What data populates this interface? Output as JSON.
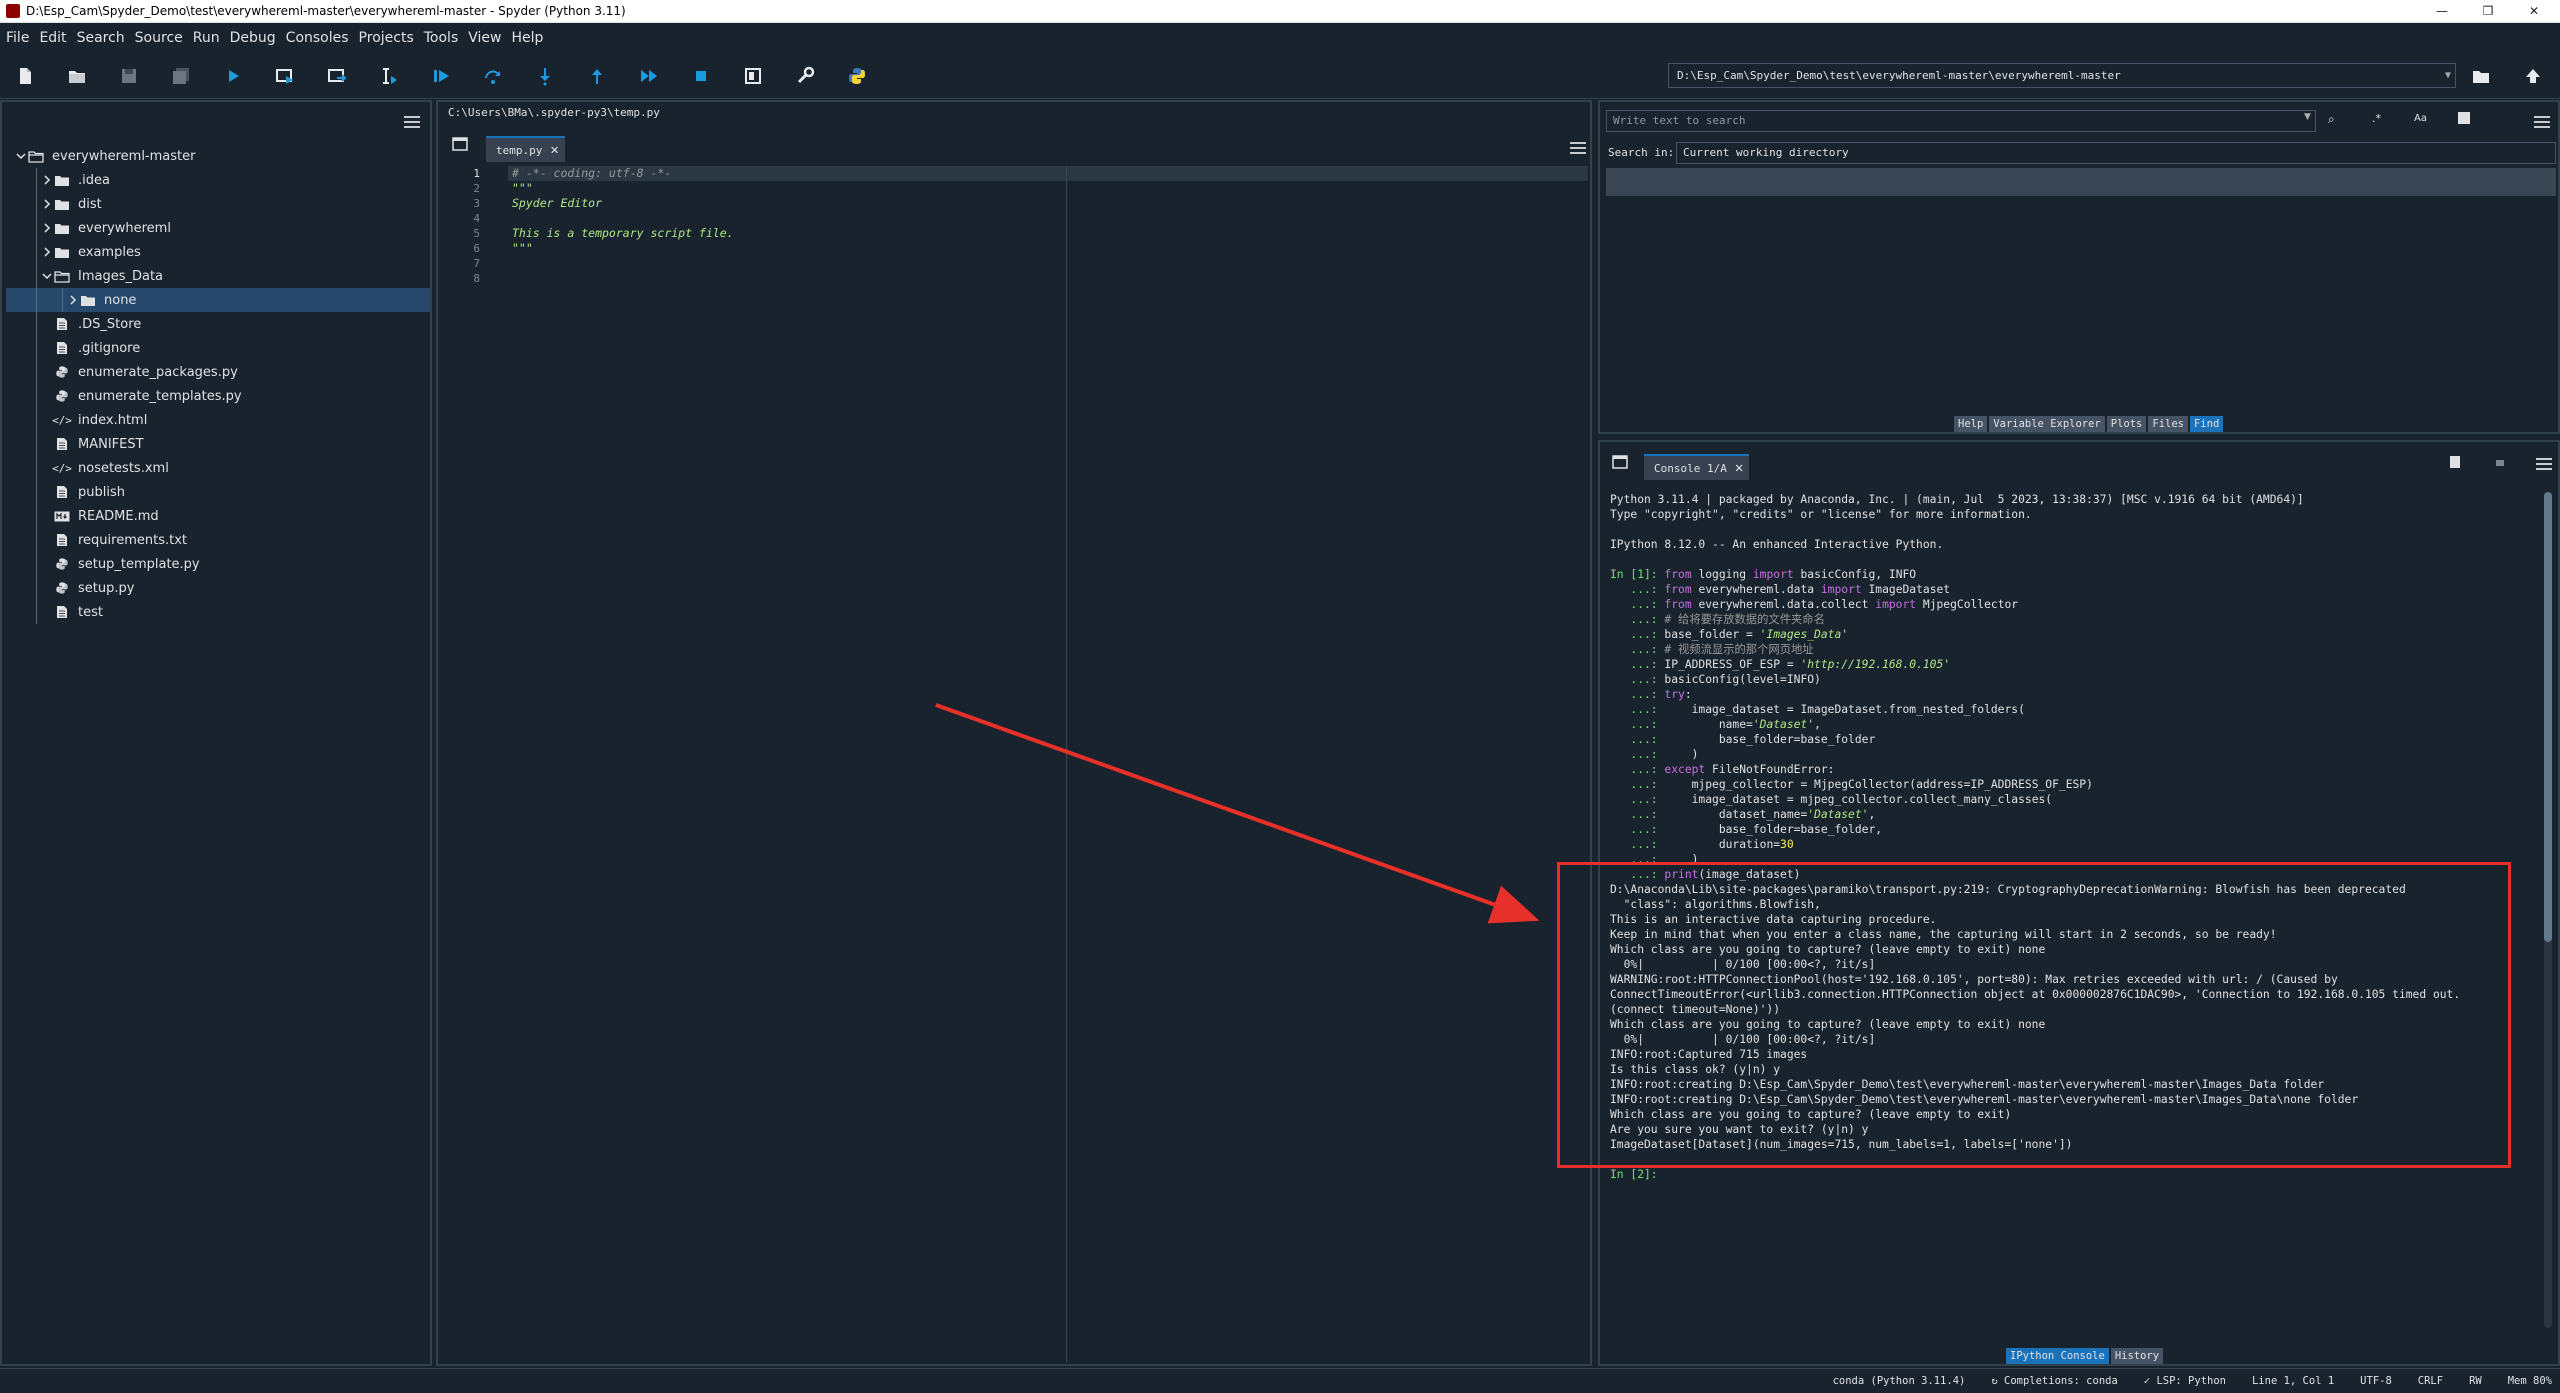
{
  "window": {
    "title": "D:\\Esp_Cam\\Spyder_Demo\\test\\everywhereml-master\\everywhereml-master - Spyder (Python 3.11)",
    "controls": [
      "—",
      "❐",
      "✕"
    ]
  },
  "menu": [
    "File",
    "Edit",
    "Search",
    "Source",
    "Run",
    "Debug",
    "Consoles",
    "Projects",
    "Tools",
    "View",
    "Help"
  ],
  "toolbar": {
    "working_dir": "D:\\Esp_Cam\\Spyder_Demo\\test\\everywhereml-master\\everywhereml-master",
    "icons": [
      "new-file-icon",
      "open-file-icon",
      "save-icon",
      "save-all-icon",
      "run-icon",
      "run-cell-icon",
      "run-cell-advance-icon",
      "run-selection-icon",
      "debug-icon",
      "step-over-icon",
      "step-into-icon",
      "step-return-icon",
      "continue-icon",
      "stop-debug-icon",
      "maximize-pane-icon",
      "preferences-icon",
      "python-path-icon"
    ]
  },
  "files": {
    "root": "everywhereml-master",
    "items": [
      {
        "label": ".idea",
        "type": "folder",
        "depth": 1,
        "expanded": false
      },
      {
        "label": "dist",
        "type": "folder",
        "depth": 1,
        "expanded": false
      },
      {
        "label": "everywhereml",
        "type": "folder",
        "depth": 1,
        "expanded": false
      },
      {
        "label": "examples",
        "type": "folder",
        "depth": 1,
        "expanded": false
      },
      {
        "label": "Images_Data",
        "type": "folder",
        "depth": 1,
        "expanded": true
      },
      {
        "label": "none",
        "type": "folder",
        "depth": 2,
        "expanded": false,
        "selected": true
      },
      {
        "label": ".DS_Store",
        "type": "file",
        "depth": 1
      },
      {
        "label": ".gitignore",
        "type": "file",
        "depth": 1
      },
      {
        "label": "enumerate_packages.py",
        "type": "python",
        "depth": 1
      },
      {
        "label": "enumerate_templates.py",
        "type": "python",
        "depth": 1
      },
      {
        "label": "index.html",
        "type": "code",
        "depth": 1
      },
      {
        "label": "MANIFEST",
        "type": "file",
        "depth": 1
      },
      {
        "label": "nosetests.xml",
        "type": "code",
        "depth": 1
      },
      {
        "label": "publish",
        "type": "file",
        "depth": 1
      },
      {
        "label": "README.md",
        "type": "markdown",
        "depth": 1
      },
      {
        "label": "requirements.txt",
        "type": "file",
        "depth": 1
      },
      {
        "label": "setup_template.py",
        "type": "python",
        "depth": 1
      },
      {
        "label": "setup.py",
        "type": "python",
        "depth": 1
      },
      {
        "label": "test",
        "type": "file",
        "depth": 1
      }
    ]
  },
  "editor": {
    "path": "C:\\Users\\BMa\\.spyder-py3\\temp.py",
    "tab_label": "temp.py",
    "line_numbers": [
      "1",
      "2",
      "3",
      "4",
      "5",
      "6",
      "7",
      "8"
    ],
    "lines": [
      {
        "text": "# -*- coding: utf-8 -*-",
        "color": "#999999",
        "italic": true
      },
      {
        "text": "\"\"\"",
        "color": "#b0e686",
        "italic": true
      },
      {
        "text": "Spyder Editor",
        "color": "#b0e686",
        "italic": true
      },
      {
        "text": "",
        "color": "#b0e686",
        "italic": true
      },
      {
        "text": "This is a temporary script file.",
        "color": "#b0e686",
        "italic": true
      },
      {
        "text": "\"\"\"",
        "color": "#b0e686",
        "italic": true
      },
      {
        "text": "",
        "color": "#e0e1e3",
        "italic": false
      },
      {
        "text": "",
        "color": "#e0e1e3",
        "italic": false
      }
    ]
  },
  "find": {
    "search_placeholder": "Write text to search",
    "search_in_label": "Search in:",
    "search_in_value": "Current working directory",
    "tabs": [
      "Help",
      "Variable Explorer",
      "Plots",
      "Files",
      "Find"
    ],
    "active_tab": "Find"
  },
  "console": {
    "tab_label": "Console 1/A",
    "bottom_tabs": [
      "IPython Console",
      "History"
    ],
    "active_bottom_tab": "IPython Console",
    "lines": [
      [
        {
          "t": "Python 3.11.4 | packaged by Anaconda, Inc. | (main, Jul  5 2023, 13:38:37) [MSC v.1916 64 bit (AMD64)]"
        }
      ],
      [
        {
          "t": "Type \"copyright\", \"credits\" or \"license\" for more information."
        }
      ],
      [
        {
          "t": ""
        }
      ],
      [
        {
          "t": "IPython 8.12.0 -- An enhanced Interactive Python."
        }
      ],
      [
        {
          "t": ""
        }
      ],
      [
        {
          "t": "In [1]: ",
          "c": "prompt"
        },
        {
          "t": "from",
          "c": "kw"
        },
        {
          "t": " logging "
        },
        {
          "t": "import",
          "c": "kw"
        },
        {
          "t": " basicConfig, INFO"
        }
      ],
      [
        {
          "t": "   ...: ",
          "c": "prompt"
        },
        {
          "t": "from",
          "c": "kw"
        },
        {
          "t": " everywhereml.data "
        },
        {
          "t": "import",
          "c": "kw"
        },
        {
          "t": " ImageDataset"
        }
      ],
      [
        {
          "t": "   ...: ",
          "c": "prompt"
        },
        {
          "t": "from",
          "c": "kw"
        },
        {
          "t": " everywhereml.data.collect "
        },
        {
          "t": "import",
          "c": "kw"
        },
        {
          "t": " MjpegCollector"
        }
      ],
      [
        {
          "t": "   ...: ",
          "c": "prompt"
        },
        {
          "t": "# 给将要存放数据的文件夹命名",
          "c": "cmt"
        }
      ],
      [
        {
          "t": "   ...: ",
          "c": "prompt"
        },
        {
          "t": "base_folder = "
        },
        {
          "t": "'Images_Data'",
          "c": "str"
        }
      ],
      [
        {
          "t": "   ...: ",
          "c": "prompt"
        },
        {
          "t": "# 视频流显示的那个网页地址",
          "c": "cmt"
        }
      ],
      [
        {
          "t": "   ...: ",
          "c": "prompt"
        },
        {
          "t": "IP_ADDRESS_OF_ESP = "
        },
        {
          "t": "'http://192.168.0.105'",
          "c": "str"
        }
      ],
      [
        {
          "t": "   ...: ",
          "c": "prompt"
        },
        {
          "t": "basicConfig(level=INFO)"
        }
      ],
      [
        {
          "t": "   ...: ",
          "c": "prompt"
        },
        {
          "t": "try",
          "c": "kw"
        },
        {
          "t": ":"
        }
      ],
      [
        {
          "t": "   ...: ",
          "c": "prompt"
        },
        {
          "t": "    image_dataset = ImageDataset.from_nested_folders("
        }
      ],
      [
        {
          "t": "   ...: ",
          "c": "prompt"
        },
        {
          "t": "        name="
        },
        {
          "t": "'Dataset'",
          "c": "str"
        },
        {
          "t": ","
        }
      ],
      [
        {
          "t": "   ...: ",
          "c": "prompt"
        },
        {
          "t": "        base_folder=base_folder"
        }
      ],
      [
        {
          "t": "   ...: ",
          "c": "prompt"
        },
        {
          "t": "    )"
        }
      ],
      [
        {
          "t": "   ...: ",
          "c": "prompt"
        },
        {
          "t": "except",
          "c": "kw"
        },
        {
          "t": " FileNotFoundError:"
        }
      ],
      [
        {
          "t": "   ...: ",
          "c": "prompt"
        },
        {
          "t": "    mjpeg_collector = MjpegCollector(address=IP_ADDRESS_OF_ESP)"
        }
      ],
      [
        {
          "t": "   ...: ",
          "c": "prompt"
        },
        {
          "t": "    image_dataset = mjpeg_collector.collect_many_classes("
        }
      ],
      [
        {
          "t": "   ...: ",
          "c": "prompt"
        },
        {
          "t": "        dataset_name="
        },
        {
          "t": "'Dataset'",
          "c": "str"
        },
        {
          "t": ","
        }
      ],
      [
        {
          "t": "   ...: ",
          "c": "prompt"
        },
        {
          "t": "        base_folder=base_folder,"
        }
      ],
      [
        {
          "t": "   ...: ",
          "c": "prompt"
        },
        {
          "t": "        duration="
        },
        {
          "t": "30",
          "c": "num"
        }
      ],
      [
        {
          "t": "   ...: ",
          "c": "prompt"
        },
        {
          "t": "    )"
        }
      ],
      [
        {
          "t": "   ...: ",
          "c": "prompt"
        },
        {
          "t": "print",
          "c": "kw"
        },
        {
          "t": "(image_dataset)"
        }
      ],
      [
        {
          "t": "D:\\Anaconda\\Lib\\site-packages\\paramiko\\transport.py:219: CryptographyDeprecationWarning: Blowfish has been deprecated"
        }
      ],
      [
        {
          "t": "  \"class\": algorithms.Blowfish,"
        }
      ],
      [
        {
          "t": "This is an interactive data capturing procedure."
        }
      ],
      [
        {
          "t": "Keep in mind that when you enter a class name, the capturing will start in 2 seconds, so be ready!"
        }
      ],
      [
        {
          "t": "Which class are you going to capture? (leave empty to exit) none"
        }
      ],
      [
        {
          "t": "  0%|          | 0/100 [00:00<?, ?it/s]"
        }
      ],
      [
        {
          "t": "WARNING:root:HTTPConnectionPool(host='192.168.0.105', port=80): Max retries exceeded with url: / (Caused by"
        }
      ],
      [
        {
          "t": "ConnectTimeoutError(<urllib3.connection.HTTPConnection object at 0x000002876C1DAC90>, 'Connection to 192.168.0.105 timed out."
        }
      ],
      [
        {
          "t": "(connect timeout=None)'))"
        }
      ],
      [
        {
          "t": "Which class are you going to capture? (leave empty to exit) none"
        }
      ],
      [
        {
          "t": "  0%|          | 0/100 [00:00<?, ?it/s]"
        }
      ],
      [
        {
          "t": "INFO:root:Captured 715 images"
        }
      ],
      [
        {
          "t": "Is this class ok? (y|n) y"
        }
      ],
      [
        {
          "t": "INFO:root:creating D:\\Esp_Cam\\Spyder_Demo\\test\\everywhereml-master\\everywhereml-master\\Images_Data folder"
        }
      ],
      [
        {
          "t": "INFO:root:creating D:\\Esp_Cam\\Spyder_Demo\\test\\everywhereml-master\\everywhereml-master\\Images_Data\\none folder"
        }
      ],
      [
        {
          "t": "Which class are you going to capture? (leave empty to exit)"
        }
      ],
      [
        {
          "t": "Are you sure you want to exit? (y|n) y"
        }
      ],
      [
        {
          "t": "ImageDataset[Dataset](num_images=715, num_labels=1, labels=['none'])"
        }
      ],
      [
        {
          "t": ""
        }
      ],
      [
        {
          "t": "In [2]:",
          "c": "prompt"
        }
      ]
    ]
  },
  "status": [
    "conda (Python 3.11.4)",
    "↻ Completions: conda",
    "✓ LSP: Python",
    "Line 1, Col 1",
    "UTF-8",
    "CRLF",
    "RW",
    "Mem 80%"
  ],
  "colors": {
    "background": "#19232d",
    "accent": "#1a72bb",
    "annotation": "#e8302b"
  }
}
